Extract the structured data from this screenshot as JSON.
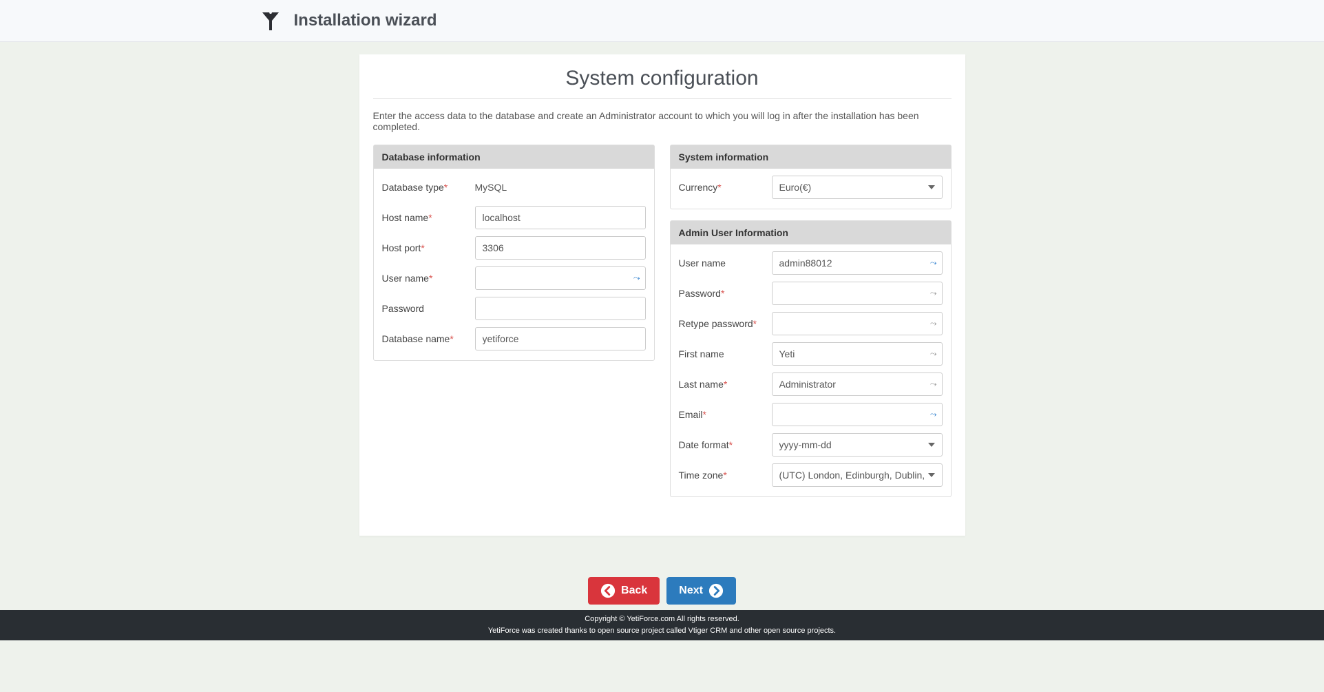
{
  "header": {
    "title": "Installation wizard"
  },
  "page": {
    "title": "System configuration",
    "intro": "Enter the access data to the database and create an Administrator account to which you will log in after the installation has been completed."
  },
  "database": {
    "panel_title": "Database information",
    "type_label": "Database type",
    "type_value": "MySQL",
    "host_label": "Host name",
    "host_value": "localhost",
    "port_label": "Host port",
    "port_value": "3306",
    "user_label": "User name",
    "user_value": "",
    "password_label": "Password",
    "password_value": "",
    "dbname_label": "Database name",
    "dbname_value": "yetiforce"
  },
  "system": {
    "panel_title": "System information",
    "currency_label": "Currency",
    "currency_value": "Euro(€)"
  },
  "admin": {
    "panel_title": "Admin User Information",
    "username_label": "User name",
    "username_value": "admin88012",
    "password_label": "Password",
    "password_value": "",
    "retype_label": "Retype password",
    "retype_value": "",
    "firstname_label": "First name",
    "firstname_value": "Yeti",
    "lastname_label": "Last name",
    "lastname_value": "Administrator",
    "email_label": "Email",
    "email_value": "",
    "dateformat_label": "Date format",
    "dateformat_value": "yyyy-mm-dd",
    "timezone_label": "Time zone",
    "timezone_value": "(UTC) London, Edinburgh, Dublin, Lisbon"
  },
  "buttons": {
    "back": "Back",
    "next": "Next"
  },
  "footer": {
    "line1": "Copyright © YetiForce.com All rights reserved.",
    "line2": "YetiForce was created thanks to open source project called Vtiger CRM and other open source projects."
  }
}
